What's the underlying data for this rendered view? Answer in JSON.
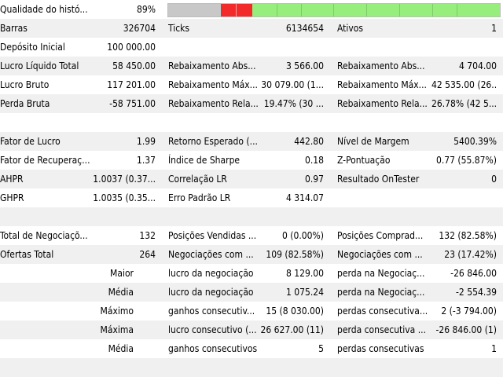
{
  "history_quality": {
    "label": "Qualidade do histó...",
    "value": "89%",
    "quality_percent": 89
  },
  "row1": {
    "l1": "Barras",
    "v1": "326704",
    "l2": "Ticks",
    "v2": "6134654",
    "l3": "Ativos",
    "v3": "1"
  },
  "row2": {
    "l1": "Depósito Inicial",
    "v1": "100 000.00"
  },
  "row3": {
    "l1": "Lucro Líquido Total",
    "v1": "58 450.00",
    "l2": "Rebaixamento Abs...",
    "v2": "3 566.00",
    "l3": "Rebaixamento Abs...",
    "v3": "4 704.00"
  },
  "row4": {
    "l1": "Lucro Bruto",
    "v1": "117 201.00",
    "l2": "Rebaixamento Máx...",
    "v2": "30 079.00 (1...",
    "l3": "Rebaixamento Máx...",
    "v3": "42 535.00 (26..."
  },
  "row5": {
    "l1": "Perda Bruta",
    "v1": "-58 751.00",
    "l2": "Rebaixamento Rela...",
    "v2": "19.47% (30 ...",
    "l3": "Rebaixamento Rela...",
    "v3": "26.78% (42 5..."
  },
  "row7": {
    "l1": "Fator de Lucro",
    "v1": "1.99",
    "l2": "Retorno Esperado (...",
    "v2": "442.80",
    "l3": "Nível de Margem",
    "v3": "5400.39%"
  },
  "row8": {
    "l1": "Fator de Recuperaç...",
    "v1": "1.37",
    "l2": "Índice de Sharpe",
    "v2": "0.18",
    "l3": "Z-Pontuação",
    "v3": "0.77 (55.87%)"
  },
  "row9": {
    "l1": "AHPR",
    "v1": "1.0037 (0.37...",
    "l2": "Correlação LR",
    "v2": "0.97",
    "l3": "Resultado OnTester",
    "v3": "0"
  },
  "row10": {
    "l1": "GHPR",
    "v1": "1.0035 (0.35...",
    "l2": "Erro Padrão LR",
    "v2": "4 314.07"
  },
  "row12": {
    "l1": "Total de Negociaçõ...",
    "v1": "132",
    "l2": "Posições Vendidas ...",
    "v2": "0 (0.00%)",
    "l3": "Posições Comprad...",
    "v3": "132 (82.58%)"
  },
  "row13": {
    "l1": "Ofertas Total",
    "v1": "264",
    "l2": "Negociações com ...",
    "v2": "109 (82.58%)",
    "l3": "Negociações com ...",
    "v3": "23 (17.42%)"
  },
  "row14": {
    "l1": "Maior",
    "l2": "lucro da negociação",
    "v2": "8 129.00",
    "l3": "perda na Negociaç...",
    "v3": "-26 846.00"
  },
  "row15": {
    "l1": "Média",
    "l2": "lucro da negociação",
    "v2": "1 075.24",
    "l3": "perda na Negociaç...",
    "v3": "-2 554.39"
  },
  "row16": {
    "l1": "Máximo",
    "l2": "ganhos consecutiv...",
    "v2": "15 (8 030.00)",
    "l3": "perdas consecutiva...",
    "v3": "2 (-3 794.00)"
  },
  "row17": {
    "l1": "Máxima",
    "l2": "lucro consecutivo (...",
    "v2": "26 627.00 (11)",
    "l3": "perda consecutiva ...",
    "v3": "-26 846.00 (1)"
  },
  "row18": {
    "l1": "Média",
    "l2": "ganhos consecutivos",
    "v2": "5",
    "l3": "perdas consecutivas",
    "v3": "1"
  },
  "colors": {
    "row_alt": "#f0f0f0",
    "bar_gray": "#c8c8c8",
    "bar_red": "#f22a2a",
    "bar_green": "#98ee7d"
  }
}
